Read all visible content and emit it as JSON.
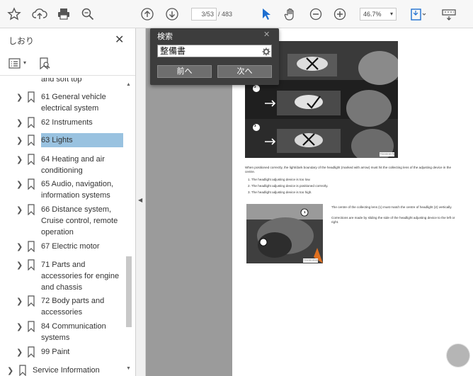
{
  "toolbar": {
    "icons": [
      "star-icon",
      "cloud-upload-icon",
      "print-icon",
      "zoom-search-icon",
      "page-up-icon",
      "page-down-icon",
      "select-cursor-icon",
      "hand-icon",
      "zoom-out-icon",
      "zoom-in-icon",
      "fit-page-icon",
      "keyboard-icon"
    ],
    "page_current": "3/53",
    "page_total": "/ 483",
    "zoom": "46.7%",
    "zoom_caret": "▾"
  },
  "sidebar": {
    "title": "しおり",
    "close": "✕",
    "options_caret": "▾",
    "items": [
      {
        "label": "and soft top"
      },
      {
        "label": "61 General vehicle electrical system"
      },
      {
        "label": "62 Instruments"
      },
      {
        "label": "63 Lights"
      },
      {
        "label": "64 Heating and air conditioning"
      },
      {
        "label": "65 Audio, navigation, information systems"
      },
      {
        "label": "66 Distance system, Cruise control, remote operation"
      },
      {
        "label": "67 Electric motor"
      },
      {
        "label": "71 Parts and accessories for engine and chassis"
      },
      {
        "label": "72 Body parts and accessories"
      },
      {
        "label": "84 Communication systems"
      },
      {
        "label": "99 Paint"
      },
      {
        "label": "Service Information"
      }
    ]
  },
  "find": {
    "title": "検索",
    "close": "✕",
    "query": "整備書",
    "prev_label": "前へ",
    "next_label": "次へ"
  },
  "document": {
    "photo_labels": [
      "1",
      "2",
      "3"
    ],
    "caption1": "When positioned correctly, the light/dark boundary of the headlight (marked with arrow) must hit the collecting lens of the adjusting device in the centre.",
    "list": [
      "1.   The headlight adjusting device is too low.",
      "2.   The headlight adjusting device is positioned correctly.",
      "3.   The headlight adjusting device is too high."
    ],
    "side_text1": "The centre of the collecting lens (1) must match the centre of headlight (2) vertically.",
    "side_text2": "Corrections are made by sliding the side of the headlight adjusting device to the left or right.",
    "photo_code1": "TD000079",
    "photo_code2": "TD000080"
  }
}
